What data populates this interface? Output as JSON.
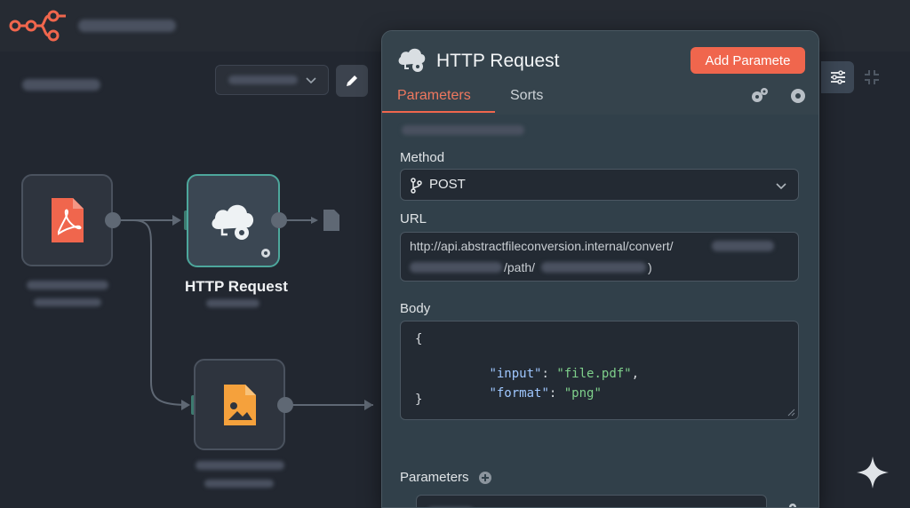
{
  "app": {
    "logo_icon": "workflow-logo-icon",
    "accent_color": "#f0664d",
    "teal_color": "#4da79c"
  },
  "canvas": {
    "nodes": [
      {
        "id": "pdf",
        "icon": "pdf-file-icon",
        "icon_color": "#f0664d"
      },
      {
        "id": "http",
        "icon": "cloud-gear-icon",
        "label": "HTTP Request"
      },
      {
        "id": "image",
        "icon": "image-file-icon",
        "icon_color": "#f5a13c"
      }
    ]
  },
  "panel": {
    "icon": "cloud-gear-icon",
    "title": "HTTP Request",
    "add_button": "Add Paramete",
    "tabs": [
      {
        "label": "Parameters",
        "active": true
      },
      {
        "label": "Sorts",
        "active": false
      }
    ],
    "method": {
      "label": "Method",
      "value": "POST",
      "icon": "branch-icon"
    },
    "url": {
      "label": "URL",
      "line1": "http://api.abstractfileconversion.internal/convert/",
      "path": "/path/",
      "close": ")"
    },
    "body": {
      "label": "Body",
      "open": "{",
      "input_key": "\"input\"",
      "input_value": "\"file.pdf\"",
      "format_key": "\"format\"",
      "format_value": "\"png\"",
      "close": "}"
    },
    "parameters": {
      "label": "Parameters"
    }
  }
}
